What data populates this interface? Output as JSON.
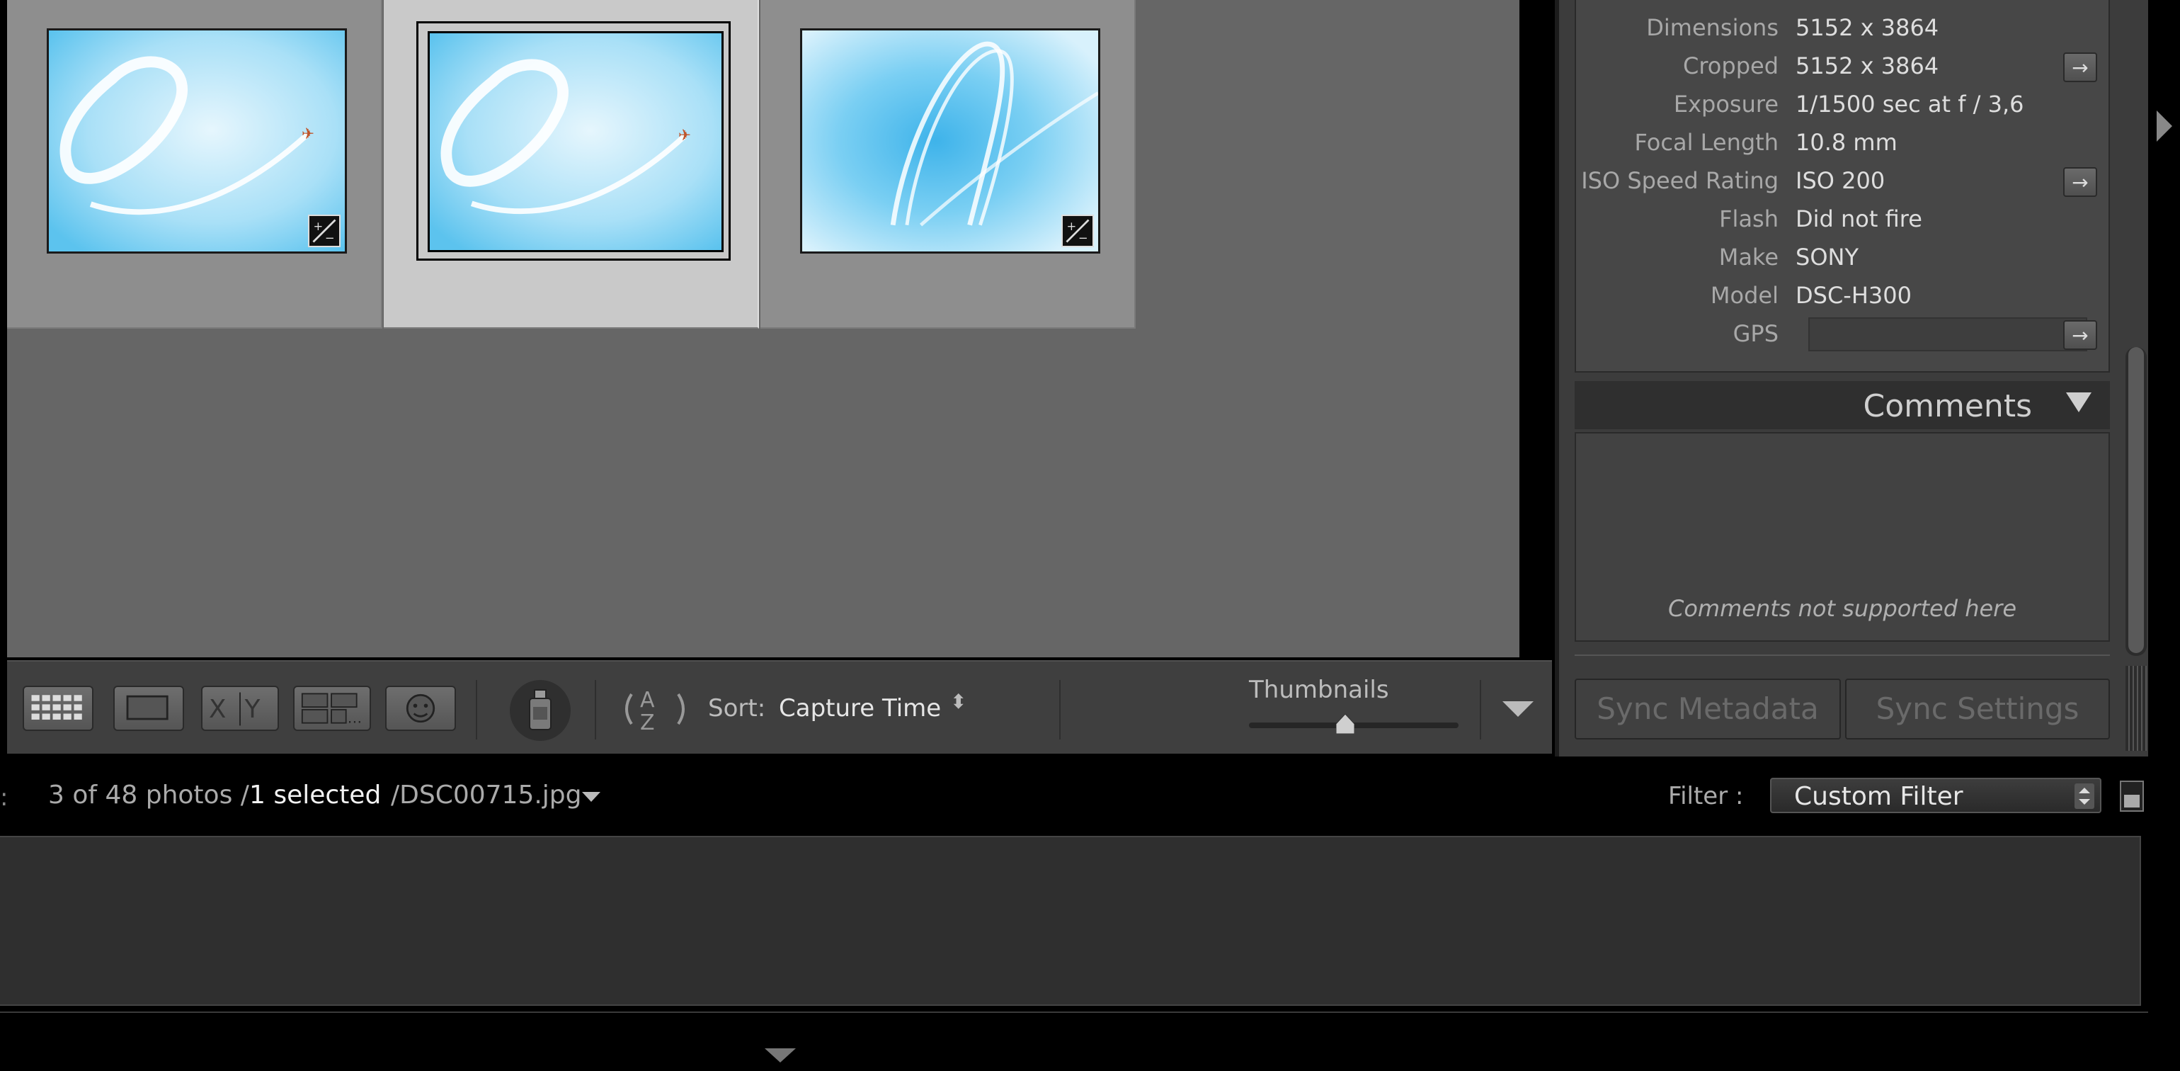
{
  "grid": {
    "cells": [
      {
        "id": "photo-1",
        "selected": false,
        "badge": true
      },
      {
        "id": "photo-2",
        "selected": true,
        "badge": false
      },
      {
        "id": "photo-3",
        "selected": false,
        "badge": true
      }
    ]
  },
  "toolbar": {
    "sort_label": "Sort:",
    "sort_value": "Capture Time",
    "thumbnails_label": "Thumbnails",
    "thumbnail_size": 0.46
  },
  "metadata": {
    "rows": [
      {
        "label": "Dimensions",
        "value": "5152 x 3864",
        "goto": false
      },
      {
        "label": "Cropped",
        "value": "5152 x 3864",
        "goto": true
      },
      {
        "label": "Exposure",
        "value": "1/1500 sec at f / 3,6",
        "goto": false
      },
      {
        "label": "Focal Length",
        "value": "10.8 mm",
        "goto": false
      },
      {
        "label": "ISO Speed Rating",
        "value": "ISO 200",
        "goto": true
      },
      {
        "label": "Flash",
        "value": "Did not fire",
        "goto": false
      },
      {
        "label": "Make",
        "value": "SONY",
        "goto": false
      },
      {
        "label": "Model",
        "value": "DSC-H300",
        "goto": false
      },
      {
        "label": "GPS",
        "value": "",
        "goto": true
      }
    ]
  },
  "comments": {
    "title": "Comments",
    "placeholder": "Comments not supported here"
  },
  "sync": {
    "metadata_label": "Sync Metadata",
    "settings_label": "Sync Settings"
  },
  "filter_bar": {
    "count_text": "3 of 48 photos /",
    "selected_text": "1 selected",
    "filename": "/DSC00715.jpg",
    "filter_label": "Filter :",
    "filter_value": "Custom Filter"
  },
  "colors": {
    "sky": "#8fd3f3",
    "panel": "#3c3c3c",
    "grid_bg": "#666666"
  }
}
